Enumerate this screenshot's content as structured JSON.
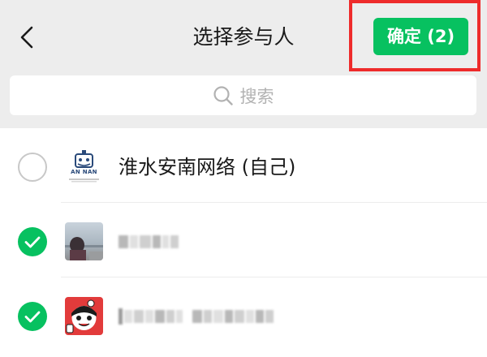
{
  "header": {
    "title": "选择参与人",
    "back_icon": "chevron-left-icon",
    "confirm_label": "确定 (2)"
  },
  "search": {
    "placeholder": "搜索",
    "icon": "search-icon"
  },
  "contacts": [
    {
      "name": "淮水安南网络 (自己)",
      "selected": false,
      "avatar_text": "AN NAN"
    },
    {
      "name": "",
      "selected": true,
      "name_obscured": true
    },
    {
      "name": "",
      "selected": true,
      "name_obscured": true
    }
  ],
  "colors": {
    "accent": "#07c160",
    "header_bg": "#ededed",
    "highlight": "#ee2b2b"
  }
}
